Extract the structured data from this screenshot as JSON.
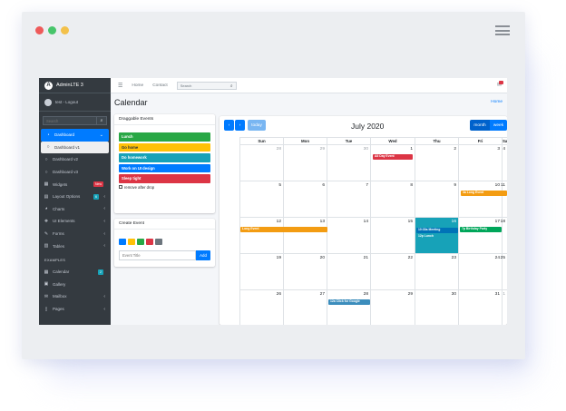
{
  "window": {
    "dot_colors": [
      "#ee5a5a",
      "#47c56b",
      "#f3c14b"
    ]
  },
  "sidebar": {
    "brand": "AdminLTE 3",
    "user": "test - Logout",
    "search_placeholder": "Search",
    "items": [
      {
        "label": "Dashboard",
        "icon": "dashboard-icon",
        "state": "active",
        "chevron": "⌄"
      },
      {
        "label": "Dashboard v1",
        "icon": "circle-icon",
        "state": "sub-active"
      },
      {
        "label": "Dashboard v2",
        "icon": "circle-icon",
        "state": ""
      },
      {
        "label": "Dashboard v3",
        "icon": "circle-icon",
        "state": ""
      },
      {
        "label": "Widgets",
        "icon": "widgets-icon",
        "state": "",
        "badge": "New",
        "badge_color": "#dc3545"
      },
      {
        "label": "Layout Options",
        "icon": "layout-icon",
        "state": "",
        "badge": "6",
        "badge_color": "#17a2b8",
        "chevron": "‹"
      },
      {
        "label": "Charts",
        "icon": "chart-pie-icon",
        "state": "",
        "chevron": "‹"
      },
      {
        "label": "UI Elements",
        "icon": "tree-icon",
        "state": "",
        "chevron": "‹"
      },
      {
        "label": "Forms",
        "icon": "edit-icon",
        "state": "",
        "chevron": "‹"
      },
      {
        "label": "Tables",
        "icon": "table-icon",
        "state": "",
        "chevron": "‹"
      }
    ],
    "section_header": "EXAMPLES",
    "examples": [
      {
        "label": "Calendar",
        "icon": "calendar-icon",
        "badge": "2",
        "badge_color": "#17a2b8"
      },
      {
        "label": "Gallery",
        "icon": "image-icon"
      },
      {
        "label": "Mailbox",
        "icon": "envelope-icon",
        "chevron": "‹"
      },
      {
        "label": "Pages",
        "icon": "book-icon",
        "chevron": "‹"
      }
    ]
  },
  "topbar": {
    "home": "Home",
    "contact": "Contact",
    "search_placeholder": "Search"
  },
  "page": {
    "title": "Calendar",
    "breadcrumb": "Home"
  },
  "draggable": {
    "title": "Draggable Events",
    "events": [
      {
        "label": "Lunch",
        "color": "#28a745",
        "dark_text": false
      },
      {
        "label": "Go home",
        "color": "#ffc107",
        "dark_text": true
      },
      {
        "label": "Do homework",
        "color": "#17a2b8",
        "dark_text": false
      },
      {
        "label": "Work on UI design",
        "color": "#007bff",
        "dark_text": false
      },
      {
        "label": "Sleep tight",
        "color": "#dc3545",
        "dark_text": false
      }
    ],
    "remove_label": "remove after drop"
  },
  "create_event": {
    "title": "Create Event",
    "colors": [
      "#007bff",
      "#ffc107",
      "#28a745",
      "#dc3545",
      "#6c757d"
    ],
    "placeholder": "Event Title",
    "add_label": "Add"
  },
  "calendar": {
    "prev": "‹",
    "next": "›",
    "today_label": "today",
    "title": "July 2020",
    "month_label": "month",
    "week_label": "week",
    "weekdays": [
      "Sun",
      "Mon",
      "Tue",
      "Wed",
      "Thu",
      "Fri",
      "Sat"
    ],
    "weeks": [
      [
        "28",
        "29",
        "30",
        "1",
        "2",
        "3",
        "4"
      ],
      [
        "5",
        "6",
        "7",
        "8",
        "9",
        "10",
        "11"
      ],
      [
        "12",
        "13",
        "14",
        "15",
        "16",
        "17",
        "18"
      ],
      [
        "19",
        "20",
        "21",
        "22",
        "23",
        "24",
        "25"
      ],
      [
        "26",
        "27",
        "28",
        "29",
        "30",
        "31",
        "1"
      ]
    ],
    "events": [
      {
        "label": "All Day Event",
        "color": "#dc3545"
      },
      {
        "label": "4a Long Event",
        "color": "#f39c12"
      },
      {
        "label": "Long Event",
        "color": "#f39c12"
      },
      {
        "label": "10:30a Meeting",
        "color": "#0073b7"
      },
      {
        "label": "12p Lunch",
        "color": "#00c0ef"
      },
      {
        "label": "7p Birthday Party",
        "color": "#00a65a"
      },
      {
        "label": "12a Click for Google",
        "color": "#3c8dbc"
      }
    ]
  }
}
